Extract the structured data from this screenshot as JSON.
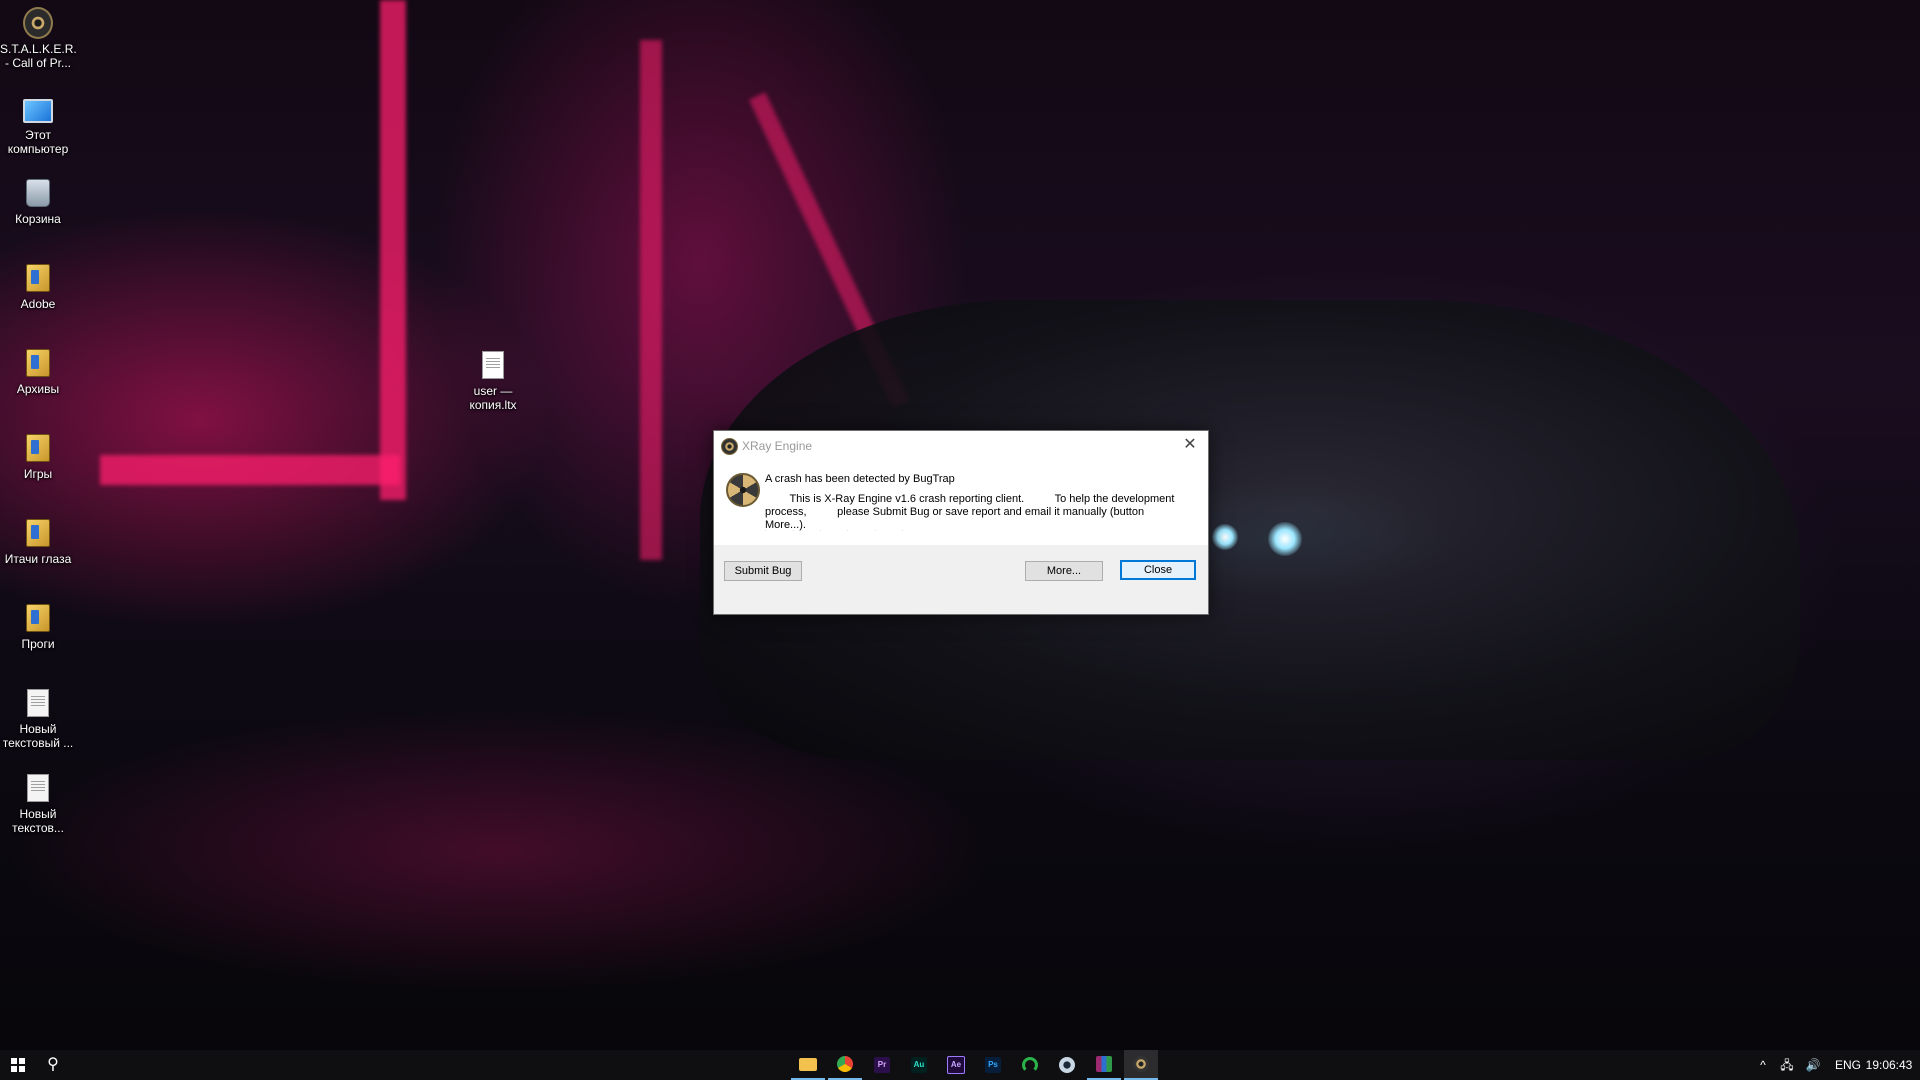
{
  "desktop": {
    "icons": [
      {
        "label": "S.T.A.L.K.E.R. - Call of Pr...",
        "icon": "stalker-game-icon"
      },
      {
        "label": "Этот компьютер",
        "icon": "computer-icon"
      },
      {
        "label": "Корзина",
        "icon": "recycle-bin-icon"
      },
      {
        "label": "Adobe",
        "icon": "folder-icon"
      },
      {
        "label": "Архивы",
        "icon": "folder-icon"
      },
      {
        "label": "Игры",
        "icon": "folder-icon"
      },
      {
        "label": "Итачи глаза",
        "icon": "folder-icon"
      },
      {
        "label": "Проги",
        "icon": "folder-icon"
      },
      {
        "label": "Новый текстовый ...",
        "icon": "text-file-icon"
      },
      {
        "label": "Новый текстов...",
        "icon": "text-file-icon"
      }
    ],
    "file_icon": {
      "label": "user — копия.ltx",
      "icon": "file-icon"
    }
  },
  "dialog": {
    "title": "XRay Engine",
    "headline": "A crash has been detected by BugTrap",
    "body": "        This is X-Ray Engine v1.6 crash reporting client.          To help the development process,          please Submit Bug or save report and email it manually (button More...).",
    "hint": ". . . . . .",
    "buttons": {
      "submit": "Submit Bug",
      "more": "More...",
      "close": "Close"
    },
    "close_glyph": "✕"
  },
  "taskbar": {
    "search_glyph": "⚲",
    "apps": [
      {
        "label": "",
        "icon": "file-explorer-icon",
        "color": "#f2c14e"
      },
      {
        "label": "",
        "icon": "chrome-icon",
        "color": "#4caf50"
      },
      {
        "label": "Pr",
        "icon": "premiere-pro-icon",
        "color": "#2a0f4a",
        "text_color": "#d9a6ff"
      },
      {
        "label": "Au",
        "icon": "audition-icon",
        "color": "#00201f",
        "text_color": "#2ee0c8"
      },
      {
        "label": "Ae",
        "icon": "after-effects-icon",
        "color": "#1f0a3a",
        "text_color": "#c8a8ff"
      },
      {
        "label": "Ps",
        "icon": "photoshop-icon",
        "color": "#061e3a",
        "text_color": "#31a8ff"
      },
      {
        "label": "",
        "icon": "headphones-icon",
        "color": "#2bb34a"
      },
      {
        "label": "",
        "icon": "steam-icon",
        "color": "#c9d6e3"
      },
      {
        "label": "",
        "icon": "winrar-icon",
        "color": "#9b2b6e"
      },
      {
        "label": "",
        "icon": "stalker-app-icon",
        "color": "#c8a86a"
      }
    ],
    "tray": {
      "chevron": "^",
      "network": "🖧",
      "volume": "🔊",
      "language": "ENG",
      "time": "19:06:43"
    }
  }
}
